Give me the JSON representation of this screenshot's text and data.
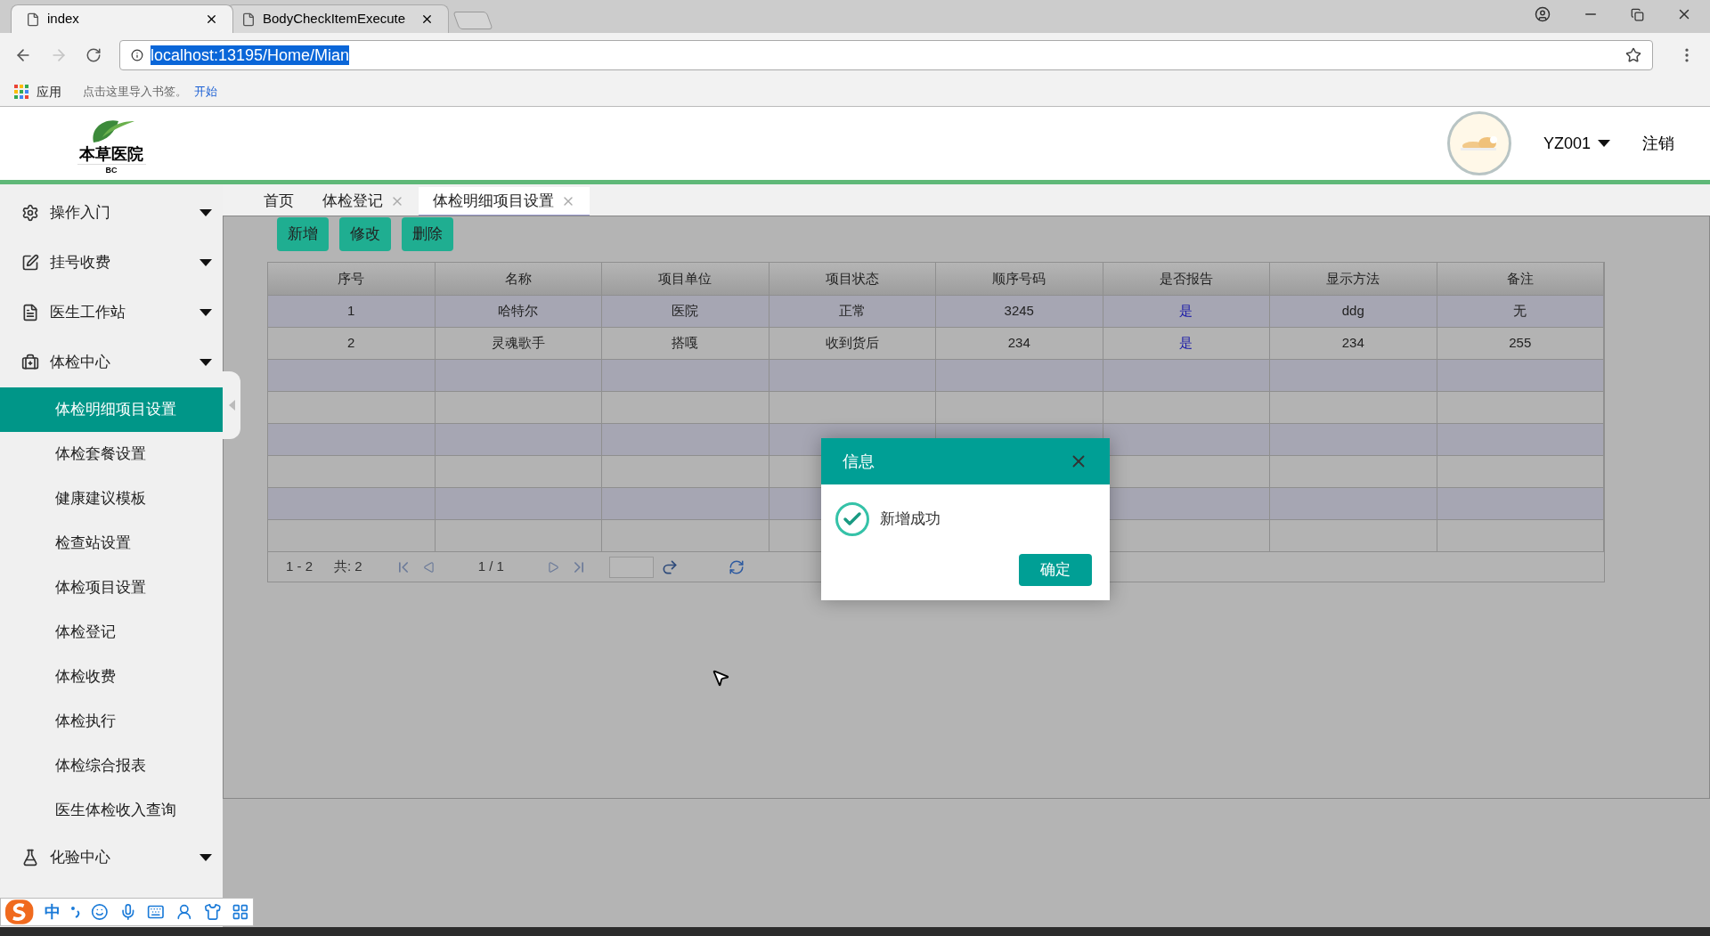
{
  "browser": {
    "tabs": [
      {
        "title": "index",
        "selected": true
      },
      {
        "title": "BodyCheckItemExecute",
        "selected": false
      }
    ],
    "address": "localhost:13195/Home/Mian",
    "bookmarks": {
      "apps": "应用",
      "hint": "点击这里导入书签。",
      "link": "开始"
    }
  },
  "header": {
    "logo_title": "本草医院",
    "logo_sub": "BC",
    "user": "YZ001",
    "logout": "注销"
  },
  "sidebar": {
    "items": [
      {
        "label": "操作入门"
      },
      {
        "label": "挂号收费"
      },
      {
        "label": "医生工作站"
      },
      {
        "label": "体检中心",
        "children": [
          {
            "label": "体检明细项目设置",
            "selected": true
          },
          {
            "label": "体检套餐设置",
            "selected": false
          },
          {
            "label": "健康建议模板",
            "selected": false
          },
          {
            "label": "检查站设置",
            "selected": false
          },
          {
            "label": "体检项目设置",
            "selected": false
          },
          {
            "label": "体检登记",
            "selected": false
          },
          {
            "label": "体检收费",
            "selected": false
          },
          {
            "label": "体检执行",
            "selected": false
          },
          {
            "label": "体检综合报表",
            "selected": false
          },
          {
            "label": "医生体检收入查询",
            "selected": false
          }
        ]
      },
      {
        "label": "化验中心"
      }
    ]
  },
  "content_tabs": [
    {
      "label": "首页",
      "closable": false,
      "selected": false
    },
    {
      "label": "体检登记",
      "closable": true,
      "selected": false
    },
    {
      "label": "体检明细项目设置",
      "closable": true,
      "selected": true
    }
  ],
  "toolbar": [
    "新增",
    "修改",
    "删除"
  ],
  "table": {
    "columns": [
      {
        "label": "序号",
        "kind": "text"
      },
      {
        "label": "名称",
        "kind": "text"
      },
      {
        "label": "项目单位",
        "kind": "text"
      },
      {
        "label": "项目状态",
        "kind": "text"
      },
      {
        "label": "顺序号码",
        "kind": "text"
      },
      {
        "label": "是否报告",
        "kind": "flag"
      },
      {
        "label": "显示方法",
        "kind": "text"
      },
      {
        "label": "备注",
        "kind": "text"
      }
    ],
    "rows": [
      [
        "1",
        "哈特尔",
        "医院",
        "正常",
        "3245",
        "是",
        "ddg",
        "无"
      ],
      [
        "2",
        "灵魂歌手",
        "搭嘎",
        "收到货后",
        "234",
        "是",
        "234",
        "255"
      ]
    ]
  },
  "pager": {
    "range": "1 - 2",
    "total": "共: 2",
    "page": "1 / 1"
  },
  "dialog": {
    "title": "信息",
    "message": "新增成功",
    "ok": "确定"
  },
  "ime": {
    "mode": "中"
  }
}
